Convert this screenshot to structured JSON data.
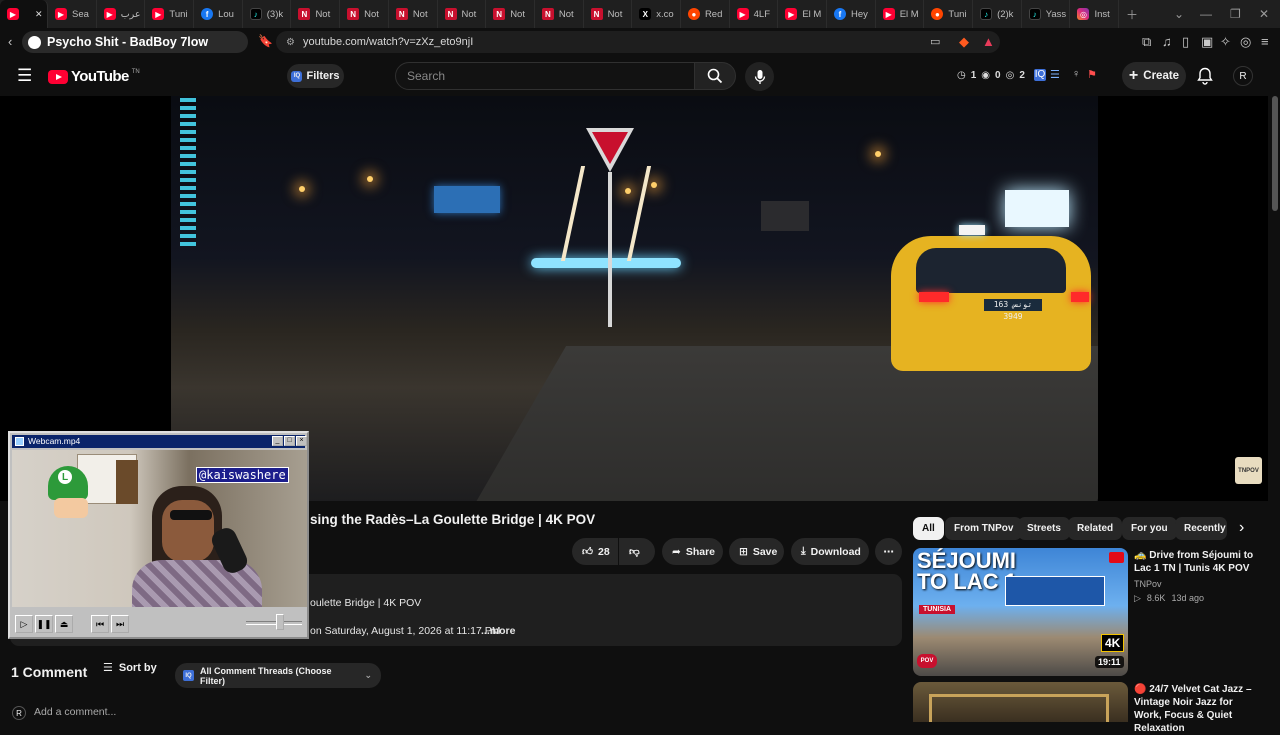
{
  "browser": {
    "tabs": [
      {
        "label": "",
        "favicon": "yt"
      },
      {
        "label": "Sea",
        "favicon": "yt"
      },
      {
        "label": "عرب",
        "favicon": "yt"
      },
      {
        "label": "Tuni",
        "favicon": "yt"
      },
      {
        "label": "Lou",
        "favicon": "fb"
      },
      {
        "label": "(3)k",
        "favicon": "tt"
      },
      {
        "label": "Not",
        "favicon": "nt"
      },
      {
        "label": "Not",
        "favicon": "nt"
      },
      {
        "label": "Not",
        "favicon": "nt"
      },
      {
        "label": "Not",
        "favicon": "nt"
      },
      {
        "label": "Not",
        "favicon": "nt"
      },
      {
        "label": "Not",
        "favicon": "nt"
      },
      {
        "label": "Not",
        "favicon": "nt"
      },
      {
        "label": "x.co",
        "favicon": "x"
      },
      {
        "label": "Red",
        "favicon": "rd"
      },
      {
        "label": "4LF",
        "favicon": "yt"
      },
      {
        "label": "El M",
        "favicon": "yt"
      },
      {
        "label": "Hey",
        "favicon": "fb"
      },
      {
        "label": "El M",
        "favicon": "yt"
      },
      {
        "label": "Tuni",
        "favicon": "rd"
      },
      {
        "label": "(2)k",
        "favicon": "tt"
      },
      {
        "label": "Yass",
        "favicon": "tt"
      },
      {
        "label": "Inst",
        "favicon": "ig"
      }
    ],
    "now_playing": "Psycho Shit - BadBoy 7low",
    "url": "youtube.com/watch?v=zXz_eto9njI"
  },
  "youtube": {
    "logo_text": "YouTube",
    "logo_sup": "TN",
    "filters_label": "Filters",
    "search_placeholder": "Search",
    "stats": {
      "a": "1",
      "b": "0",
      "c": "2"
    },
    "create_label": "Create",
    "avatar_letter": "R"
  },
  "video": {
    "title": "sing the Radès–La Goulette Bridge | 4K POV",
    "plate": "163 تونس 3949",
    "channel_badge": "TNPOV"
  },
  "actions": {
    "likes": "28",
    "share": "Share",
    "save": "Save",
    "download": "Download"
  },
  "description": {
    "line1": "oulette Bridge | 4K POV",
    "line2": "on Saturday, August 1, 2026 at 11:17 PM",
    "more": "...more"
  },
  "comments": {
    "count": "1 Comment",
    "sort": "Sort by",
    "filter": "All Comment Threads (Choose Filter)",
    "add": "Add a comment...",
    "avatar_letter": "R"
  },
  "chips": [
    "All",
    "From TNPov",
    "Streets",
    "Related",
    "For you",
    "Recently"
  ],
  "related": [
    {
      "title": "🚕 Drive from Séjoumi to Lac 1 TN | Tunis 4K POV",
      "channel": "TNPov",
      "views": "8.6K",
      "age": "13d ago",
      "duration": "19:11",
      "thumb_text": "SÉJOUMI TO LAC 1",
      "thumb_sub": "TUNISIA",
      "thumb_badge": "4K",
      "thumb_corner": "POV"
    },
    {
      "title": "🔴 24/7 Velvet Cat Jazz – Vintage Noir Jazz for Work, Focus & Quiet Relaxation"
    }
  ],
  "webcam": {
    "window_title": "Webcam.mp4",
    "handle": "@kaiswashere"
  },
  "colors": {
    "bg": "#0f0f0f",
    "brand_red": "#ff0033",
    "taxi": "#e6b321",
    "win_title": "#0a246a"
  }
}
